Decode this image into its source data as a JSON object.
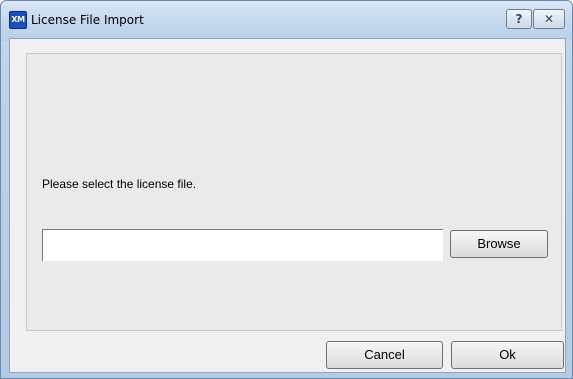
{
  "window": {
    "title": "License File Import",
    "app_icon_text": "XM",
    "help_label": "?",
    "close_label": "✕"
  },
  "main": {
    "prompt": "Please select the license file.",
    "file_input": {
      "value": "",
      "placeholder": ""
    },
    "browse_label": "Browse"
  },
  "footer": {
    "cancel_label": "Cancel",
    "ok_label": "Ok"
  }
}
